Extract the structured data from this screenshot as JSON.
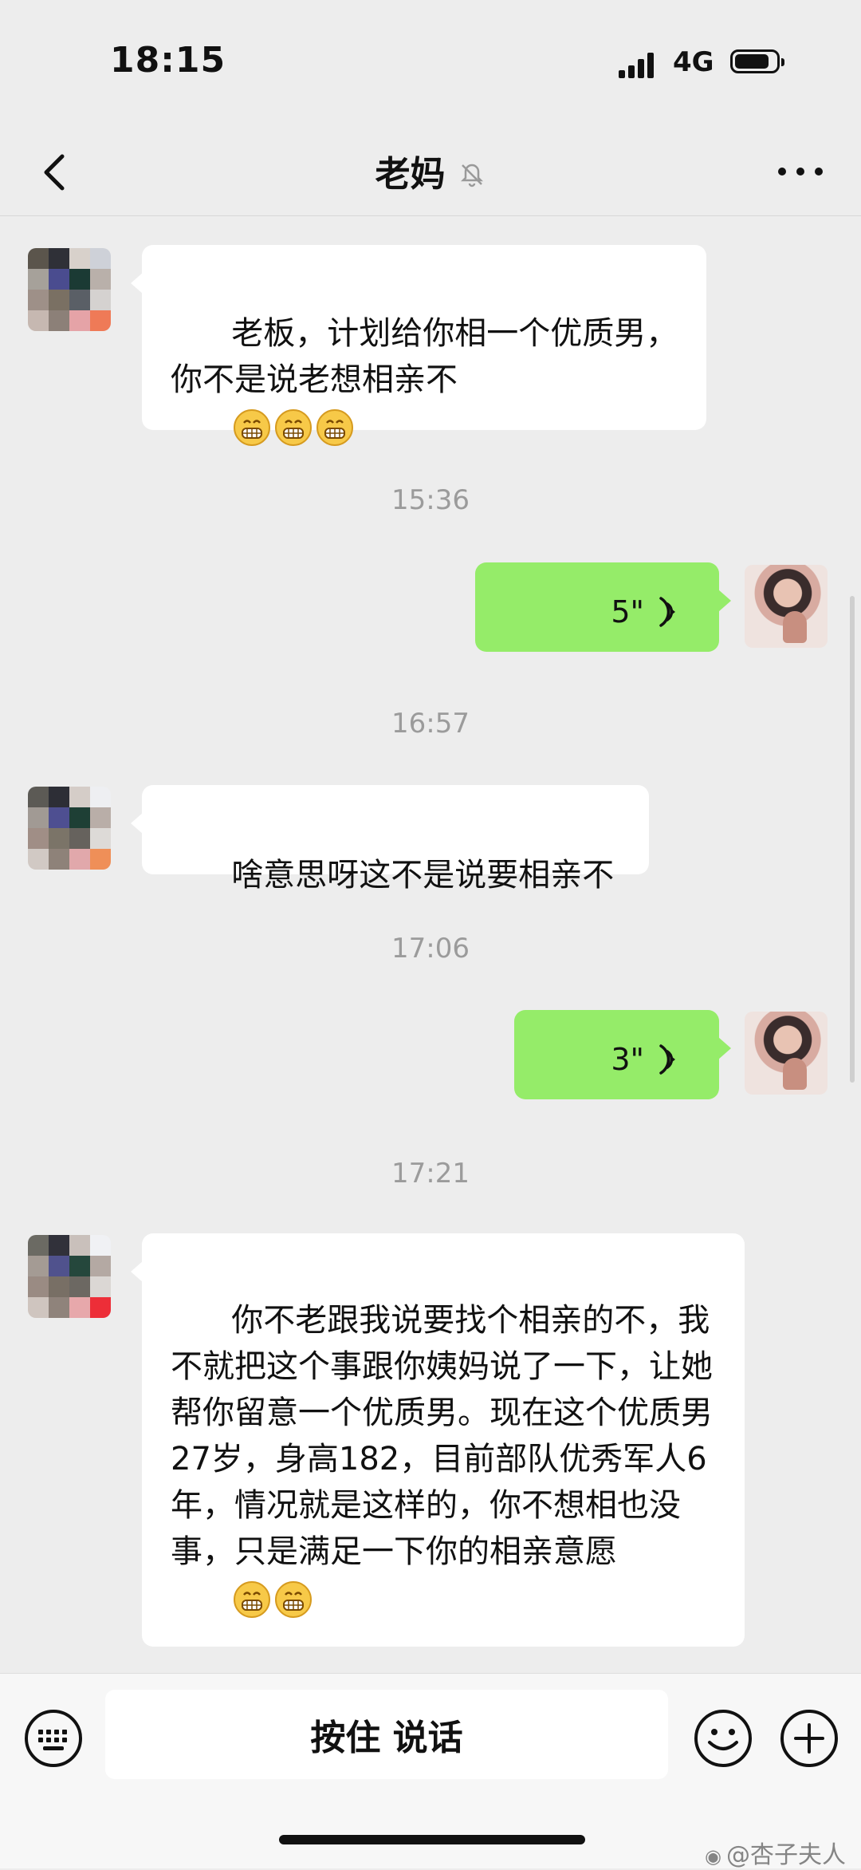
{
  "status_bar": {
    "time": "18:15",
    "network": "4G"
  },
  "header": {
    "title": "老妈"
  },
  "messages": {
    "m1": {
      "sender": "other",
      "text": "老板，计划给你相一个优质男，你不是说老想相亲不"
    },
    "time1": "15:36",
    "m2": {
      "sender": "self",
      "voice_duration": "5\""
    },
    "time2": "16:57",
    "m3": {
      "sender": "other",
      "text": "啥意思呀这不是说要相亲不"
    },
    "time3": "17:06",
    "m4": {
      "sender": "self",
      "voice_duration": "3\""
    },
    "time4": "17:21",
    "m5": {
      "sender": "other",
      "text": "你不老跟我说要找个相亲的不，我不就把这个事跟你姨妈说了一下，让她帮你留意一个优质男。现在这个优质男27岁，身高182，目前部队优秀军人6年，情况就是这样的，你不想相也没事，只是满足一下你的相亲意愿"
    }
  },
  "input_bar": {
    "talk_label": "按住 说话"
  },
  "watermark": {
    "text": "@杏子夫人"
  },
  "icons": {
    "back": "back-arrow-icon",
    "mute": "mute-bell-icon",
    "more": "more-icon",
    "voice": "voice-wave-icon",
    "keyboard": "keyboard-icon",
    "emoji": "emoji-icon",
    "plus": "plus-icon",
    "grin_emoji": "grin-emoji-icon"
  },
  "colors": {
    "background": "#ededed",
    "incoming_bubble": "#ffffff",
    "outgoing_bubble": "#95ec69",
    "timestamp": "#9b9b9b"
  }
}
